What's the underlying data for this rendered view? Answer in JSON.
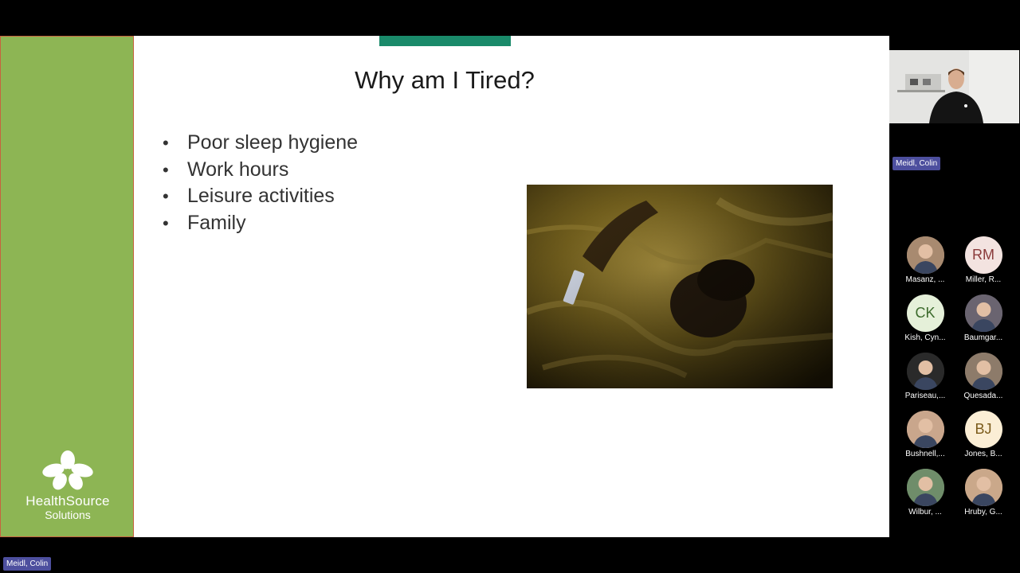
{
  "slide": {
    "title": "Why am I Tired?",
    "bullets": [
      "Poor sleep hygiene",
      "Work hours",
      "Leisure activities",
      "Family"
    ],
    "logo": {
      "name": "HealthSource",
      "sub": "Solutions"
    },
    "colors": {
      "sidebar": "#8db554",
      "accent_bar": "#1a8a6a"
    }
  },
  "presenter": {
    "name": "Meidl, Colin"
  },
  "bottom_tag": "Meidl, Colin",
  "participants": [
    {
      "name": "Masanz, ...",
      "initials": "",
      "type": "photo",
      "bg": "#a88a70"
    },
    {
      "name": "Miller, R...",
      "initials": "RM",
      "type": "initials",
      "bg": "#f3e3e0",
      "fg": "#8a3a3a"
    },
    {
      "name": "Kish, Cyn...",
      "initials": "CK",
      "type": "initials",
      "bg": "#e5f0d9",
      "fg": "#3d6b2d"
    },
    {
      "name": "Baumgar...",
      "initials": "",
      "type": "photo",
      "bg": "#6a6470"
    },
    {
      "name": "Pariseau,...",
      "initials": "",
      "type": "photo",
      "bg": "#2a2a2a"
    },
    {
      "name": "Quesada...",
      "initials": "",
      "type": "photo",
      "bg": "#8d7b6a"
    },
    {
      "name": "Bushnell,...",
      "initials": "",
      "type": "photo",
      "bg": "#c9a68c"
    },
    {
      "name": "Jones, B...",
      "initials": "BJ",
      "type": "initials",
      "bg": "#fbeed5",
      "fg": "#7a5a1a"
    },
    {
      "name": "Wilbur, ...",
      "initials": "",
      "type": "photo",
      "bg": "#6f8d6a"
    },
    {
      "name": "Hruby, G...",
      "initials": "",
      "type": "photo",
      "bg": "#caa88a"
    }
  ]
}
